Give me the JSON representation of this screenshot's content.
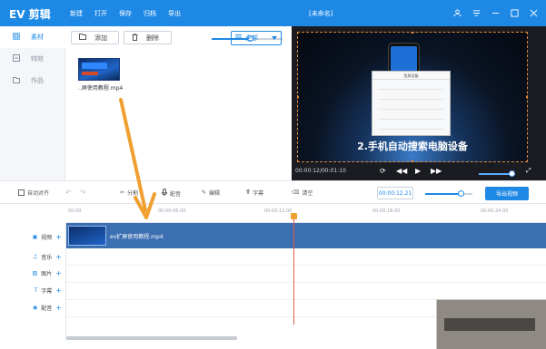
{
  "app": {
    "logo": "EV 剪辑",
    "menu": [
      "新建",
      "打开",
      "保存",
      "归档",
      "导出"
    ],
    "doc_title": "[未命名]"
  },
  "sidebar": {
    "items": [
      {
        "label": "素材",
        "icon": "grid-icon"
      },
      {
        "label": "特效",
        "icon": "effects-icon"
      },
      {
        "label": "作品",
        "icon": "folder-icon"
      }
    ]
  },
  "library": {
    "add_label": "添加",
    "delete_label": "删除",
    "filter_value": "全部",
    "zoom": 0.55,
    "media": [
      {
        "name": "..屏使用教程.mp4"
      }
    ]
  },
  "preview": {
    "subtitle": "2.手机自动搜索电脑设备",
    "time": "00:00:12/00:01:10",
    "dialog_title": "投屏设备",
    "volume": 0.9
  },
  "edit_toolbar": {
    "auto_align": "自动对齐",
    "split": "分割",
    "dub": "配音",
    "edit": "编辑",
    "subtitle": "字幕",
    "clear": "清空",
    "current_time": "00:00:12.21",
    "export": "导出视频",
    "zoom": 0.75
  },
  "timeline": {
    "ticks": [
      "00:00",
      "00:00:06.00",
      "00:00:12.00",
      "00:00:18.00",
      "00:00:24.00"
    ],
    "tracks": [
      {
        "label": "视频",
        "icon": "video-icon"
      },
      {
        "label": "音乐",
        "icon": "music-icon"
      },
      {
        "label": "图片",
        "icon": "image-icon"
      },
      {
        "label": "字幕",
        "icon": "text-icon"
      },
      {
        "label": "配音",
        "icon": "mic-icon"
      }
    ],
    "clip_name": "ev扩屏使用教程.mp4"
  },
  "colors": {
    "brand": "#1e88e5",
    "annotation_arrow": "#f0a030",
    "playhead": "#e05a4a"
  }
}
